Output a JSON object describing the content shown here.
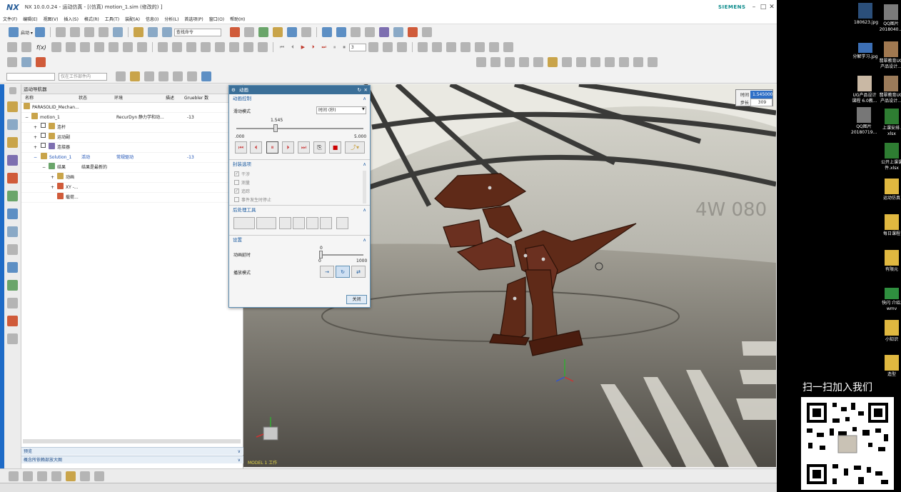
{
  "app": {
    "title": "NX 10.0.0.24 - 运动仿真 - [(仿真) motion_1.sim  (修改的)  ]",
    "logo": "NX",
    "brand": "SIEMENS"
  },
  "menu": [
    "文件(F)",
    "编辑(E)",
    "视图(V)",
    "插入(S)",
    "格式(R)",
    "工具(T)",
    "装配(A)",
    "信息(I)",
    "分析(L)",
    "首选项(P)",
    "窗口(O)",
    "帮助(H)"
  ],
  "toolbar": {
    "start_label": "启动 ▾",
    "search_placeholder": "查找命令",
    "filter_select": "",
    "scope_select": "仅在工作部件内",
    "step_value": "3"
  },
  "navigator": {
    "title": "运动导航器",
    "columns": [
      "名称",
      "状态",
      "环境",
      "描述",
      "Gruebler 数"
    ],
    "rows": [
      {
        "name": "PARASOLID_Mechan...",
        "status": "",
        "env": "",
        "desc": "",
        "num": ""
      },
      {
        "name": "motion_1",
        "status": "",
        "env": "RecurDyn 静力学和动...",
        "desc": "",
        "num": "-13"
      },
      {
        "name": "连杆",
        "status": "",
        "env": "",
        "desc": "",
        "num": ""
      },
      {
        "name": "运动副",
        "status": "",
        "env": "",
        "desc": "",
        "num": ""
      },
      {
        "name": "连接器",
        "status": "",
        "env": "",
        "desc": "",
        "num": ""
      },
      {
        "name": "Solution_1",
        "status": "活动",
        "env": "常规驱动",
        "desc": "",
        "num": "-13"
      },
      {
        "name": "结果",
        "status": "结果是最新的",
        "env": "",
        "desc": "",
        "num": ""
      },
      {
        "name": "动画",
        "status": "",
        "env": "",
        "desc": "",
        "num": ""
      },
      {
        "name": "XY -...",
        "status": "",
        "env": "",
        "desc": "",
        "num": ""
      },
      {
        "name": "载荷...",
        "status": "",
        "env": "",
        "desc": "",
        "num": ""
      }
    ],
    "preview_label": "预览",
    "dependency_label": "概念所依赖部放大图"
  },
  "dialog": {
    "title": "动画",
    "section_anim": "动画控制",
    "slider_mode_label": "滑动模式",
    "slider_mode_value": "时间 (秒)",
    "slider_value": "1.545",
    "slider_min": ".000",
    "slider_max": "5.000",
    "slider_fraction": 0.309,
    "section_check": "封装选项",
    "check_items": [
      "干涉",
      "测量",
      "追踪",
      "事件发生时停止"
    ],
    "check_states": [
      true,
      false,
      true,
      false
    ],
    "section_post": "后处理工具",
    "section_settings": "设置",
    "delay_label": "动画延时",
    "delay_value": "0",
    "delay_min": "0",
    "delay_max": "1000",
    "playback_label": "播放模式",
    "close_button": "关闭"
  },
  "viewport": {
    "time_label": "时间",
    "time_value": "1.545000",
    "step_label": "步长",
    "step_value": "309",
    "wall_text": "4W 080",
    "model_label": "MODEL 1 工作"
  },
  "desktop": {
    "icons": [
      {
        "label": "180623.jpg",
        "color": "#2b4f7a"
      },
      {
        "label": "QQ图片 2018040...",
        "color": "#7b7b7b"
      },
      {
        "label": "分解学习.jpg",
        "color": "#3c6fb5"
      },
      {
        "label": "翡翠教育UG 产品设计...",
        "color": "#a07850"
      },
      {
        "label": "UG产品设计 课程 6.0教...",
        "color": "#c9b8a4"
      },
      {
        "label": "翡翠教育UG 产品设计...",
        "color": "#9b7b5a"
      },
      {
        "label": "QQ图片 20180719...",
        "color": "#777"
      },
      {
        "label": "上课安排. xlsx",
        "color": "#2e7d32"
      },
      {
        "label": "公开上课课 件.xlsx",
        "color": "#2e7d32"
      },
      {
        "label": "运动仿真",
        "color": "#e0b840"
      },
      {
        "label": "每日课程",
        "color": "#e0b840"
      },
      {
        "label": "有限元",
        "color": "#e0b840"
      },
      {
        "label": "快闪 介绍. wmv",
        "color": "#2f8f3f"
      },
      {
        "label": "小知识",
        "color": "#e0b840"
      },
      {
        "label": "造型",
        "color": "#e0b840"
      }
    ],
    "qr_caption": "扫一扫加入我们"
  },
  "colors": {
    "accent": "#1e6bc7",
    "dialog_title": "#3b6f98",
    "model": "#6a2e1c"
  }
}
